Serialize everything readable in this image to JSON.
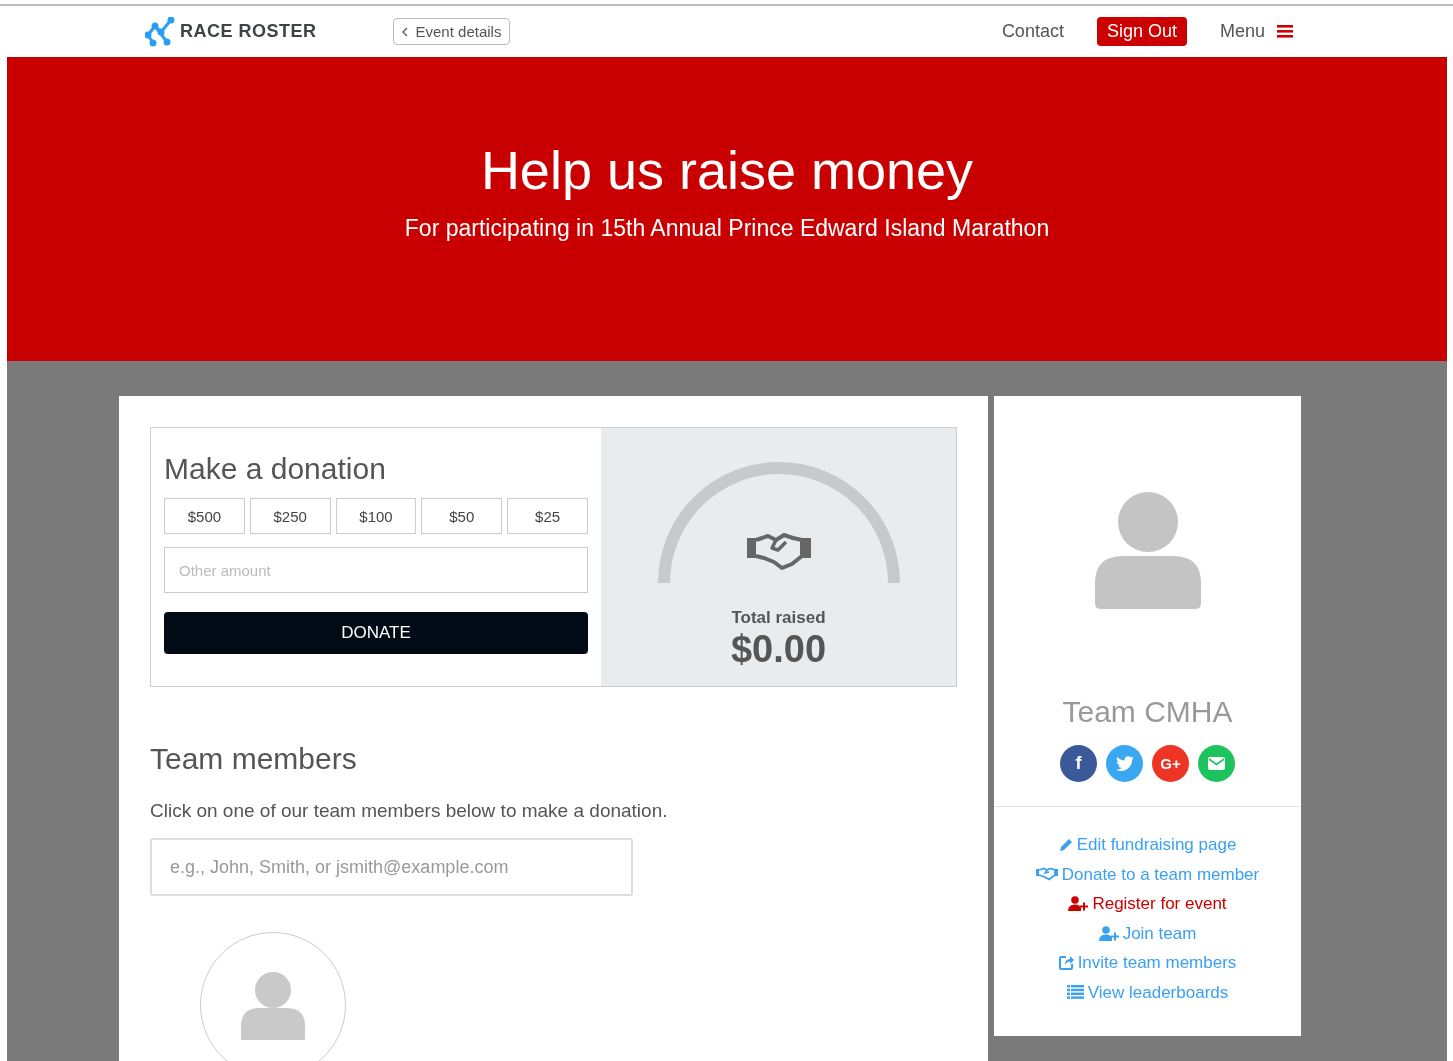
{
  "header": {
    "logo": "RACE ROSTER",
    "back_button": "Event details",
    "nav": [
      {
        "label": "Contact",
        "kind": "link"
      },
      {
        "label": "Sign Out",
        "kind": "button"
      },
      {
        "label": "Menu",
        "kind": "menu"
      }
    ]
  },
  "hero": {
    "title": "Help us raise money",
    "subtitle": "For participating in 15th Annual Prince Edward Island Marathon"
  },
  "donation": {
    "title": "Make a donation",
    "amounts": [
      "$500",
      "$250",
      "$100",
      "$50",
      "$25"
    ],
    "other_amount": {
      "placeholder": "Other amount"
    },
    "donate_button": "DONATE",
    "total_label": "Total raised",
    "total": "$0.00"
  },
  "team_members": {
    "title": "Team members",
    "intro": "Click on one of our team members below to make a donation.",
    "search": {
      "placeholder": "e.g., John, Smith, or jsmith@example.com"
    }
  },
  "team": {
    "name": "Team CMHA",
    "social": [
      {
        "kind": "facebook",
        "label": "f",
        "color": "#3b5998"
      },
      {
        "kind": "twitter",
        "color": "#3aa8f0"
      },
      {
        "kind": "google",
        "label": "G+",
        "color": "#ee3424"
      },
      {
        "kind": "email",
        "color": "#1fc35e"
      }
    ],
    "links": [
      {
        "label": "Edit fundraising page",
        "kind": "pencil",
        "color": "#3aa0f0"
      },
      {
        "label": "Donate to a team member",
        "kind": "handshake",
        "color": "#3aa0f0"
      },
      {
        "label": "Register for event",
        "kind": "user-plus",
        "color": "#cc0000"
      },
      {
        "label": "Join team",
        "kind": "user-plus",
        "color": "#3aa0f0"
      },
      {
        "label": "Invite team members",
        "kind": "share",
        "color": "#3aa0f0"
      },
      {
        "label": "View leaderboards",
        "kind": "list",
        "color": "#3aa0f0"
      }
    ]
  }
}
